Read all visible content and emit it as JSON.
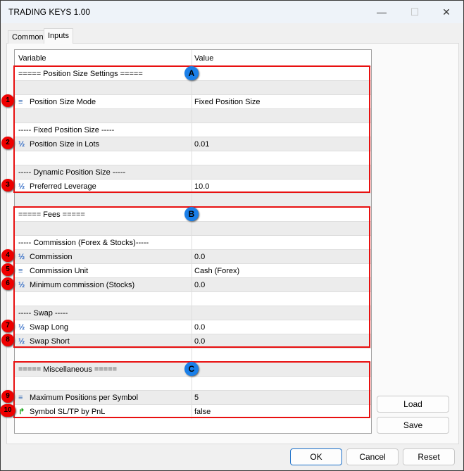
{
  "window": {
    "title": "TRADING KEYS 1.00",
    "minimize": "—",
    "maximize": "☐",
    "close": "✕"
  },
  "tabs": [
    {
      "label": "Common"
    },
    {
      "label": "Inputs"
    }
  ],
  "grid": {
    "headers": {
      "variable": "Variable",
      "value": "Value"
    },
    "rows": [
      {
        "var": "===== Position Size Settings =====",
        "val": "",
        "icon": ""
      },
      {
        "var": "",
        "val": "",
        "icon": ""
      },
      {
        "var": "Position Size Mode",
        "val": "Fixed Position Size",
        "icon": "enum-icon",
        "badge": "1"
      },
      {
        "var": "",
        "val": "",
        "icon": ""
      },
      {
        "var": "----- Fixed Position Size -----",
        "val": "",
        "icon": ""
      },
      {
        "var": "Position Size in Lots",
        "val": "0.01",
        "icon": "fraction-icon",
        "badge": "2"
      },
      {
        "var": "",
        "val": "",
        "icon": ""
      },
      {
        "var": "----- Dynamic Position Size -----",
        "val": "",
        "icon": ""
      },
      {
        "var": "Preferred Leverage",
        "val": "10.0",
        "icon": "fraction-icon",
        "badge": "3"
      },
      {
        "var": "",
        "val": "",
        "icon": ""
      },
      {
        "var": "===== Fees =====",
        "val": "",
        "icon": ""
      },
      {
        "var": "",
        "val": "",
        "icon": ""
      },
      {
        "var": "----- Commission (Forex & Stocks)-----",
        "val": "",
        "icon": ""
      },
      {
        "var": "Commission",
        "val": "0.0",
        "icon": "fraction-icon",
        "badge": "4"
      },
      {
        "var": "Commission Unit",
        "val": "Cash (Forex)",
        "icon": "enum-icon",
        "badge": "5"
      },
      {
        "var": "Minimum commission (Stocks)",
        "val": "0.0",
        "icon": "fraction-icon",
        "badge": "6"
      },
      {
        "var": "",
        "val": "",
        "icon": ""
      },
      {
        "var": "----- Swap -----",
        "val": "",
        "icon": ""
      },
      {
        "var": "Swap Long",
        "val": "0.0",
        "icon": "fraction-icon",
        "badge": "7"
      },
      {
        "var": "Swap Short",
        "val": "0.0",
        "icon": "fraction-icon",
        "badge": "8"
      },
      {
        "var": "",
        "val": "",
        "icon": ""
      },
      {
        "var": "===== Miscellaneous =====",
        "val": "",
        "icon": ""
      },
      {
        "var": "",
        "val": "",
        "icon": ""
      },
      {
        "var": "Maximum Positions per Symbol",
        "val": "5",
        "icon": "enum-icon",
        "badge": "9"
      },
      {
        "var": "Symbol SL/TP by PnL",
        "val": "false",
        "icon": "bool-icon",
        "badge": "10"
      }
    ]
  },
  "sections": [
    {
      "label": "A"
    },
    {
      "label": "B"
    },
    {
      "label": "C"
    }
  ],
  "side_buttons": {
    "load": "Load",
    "save": "Save"
  },
  "footer": {
    "ok": "OK",
    "cancel": "Cancel",
    "reset": "Reset"
  },
  "colors": {
    "highlight": "#e81010",
    "section_badge": "#1a7fe8"
  }
}
